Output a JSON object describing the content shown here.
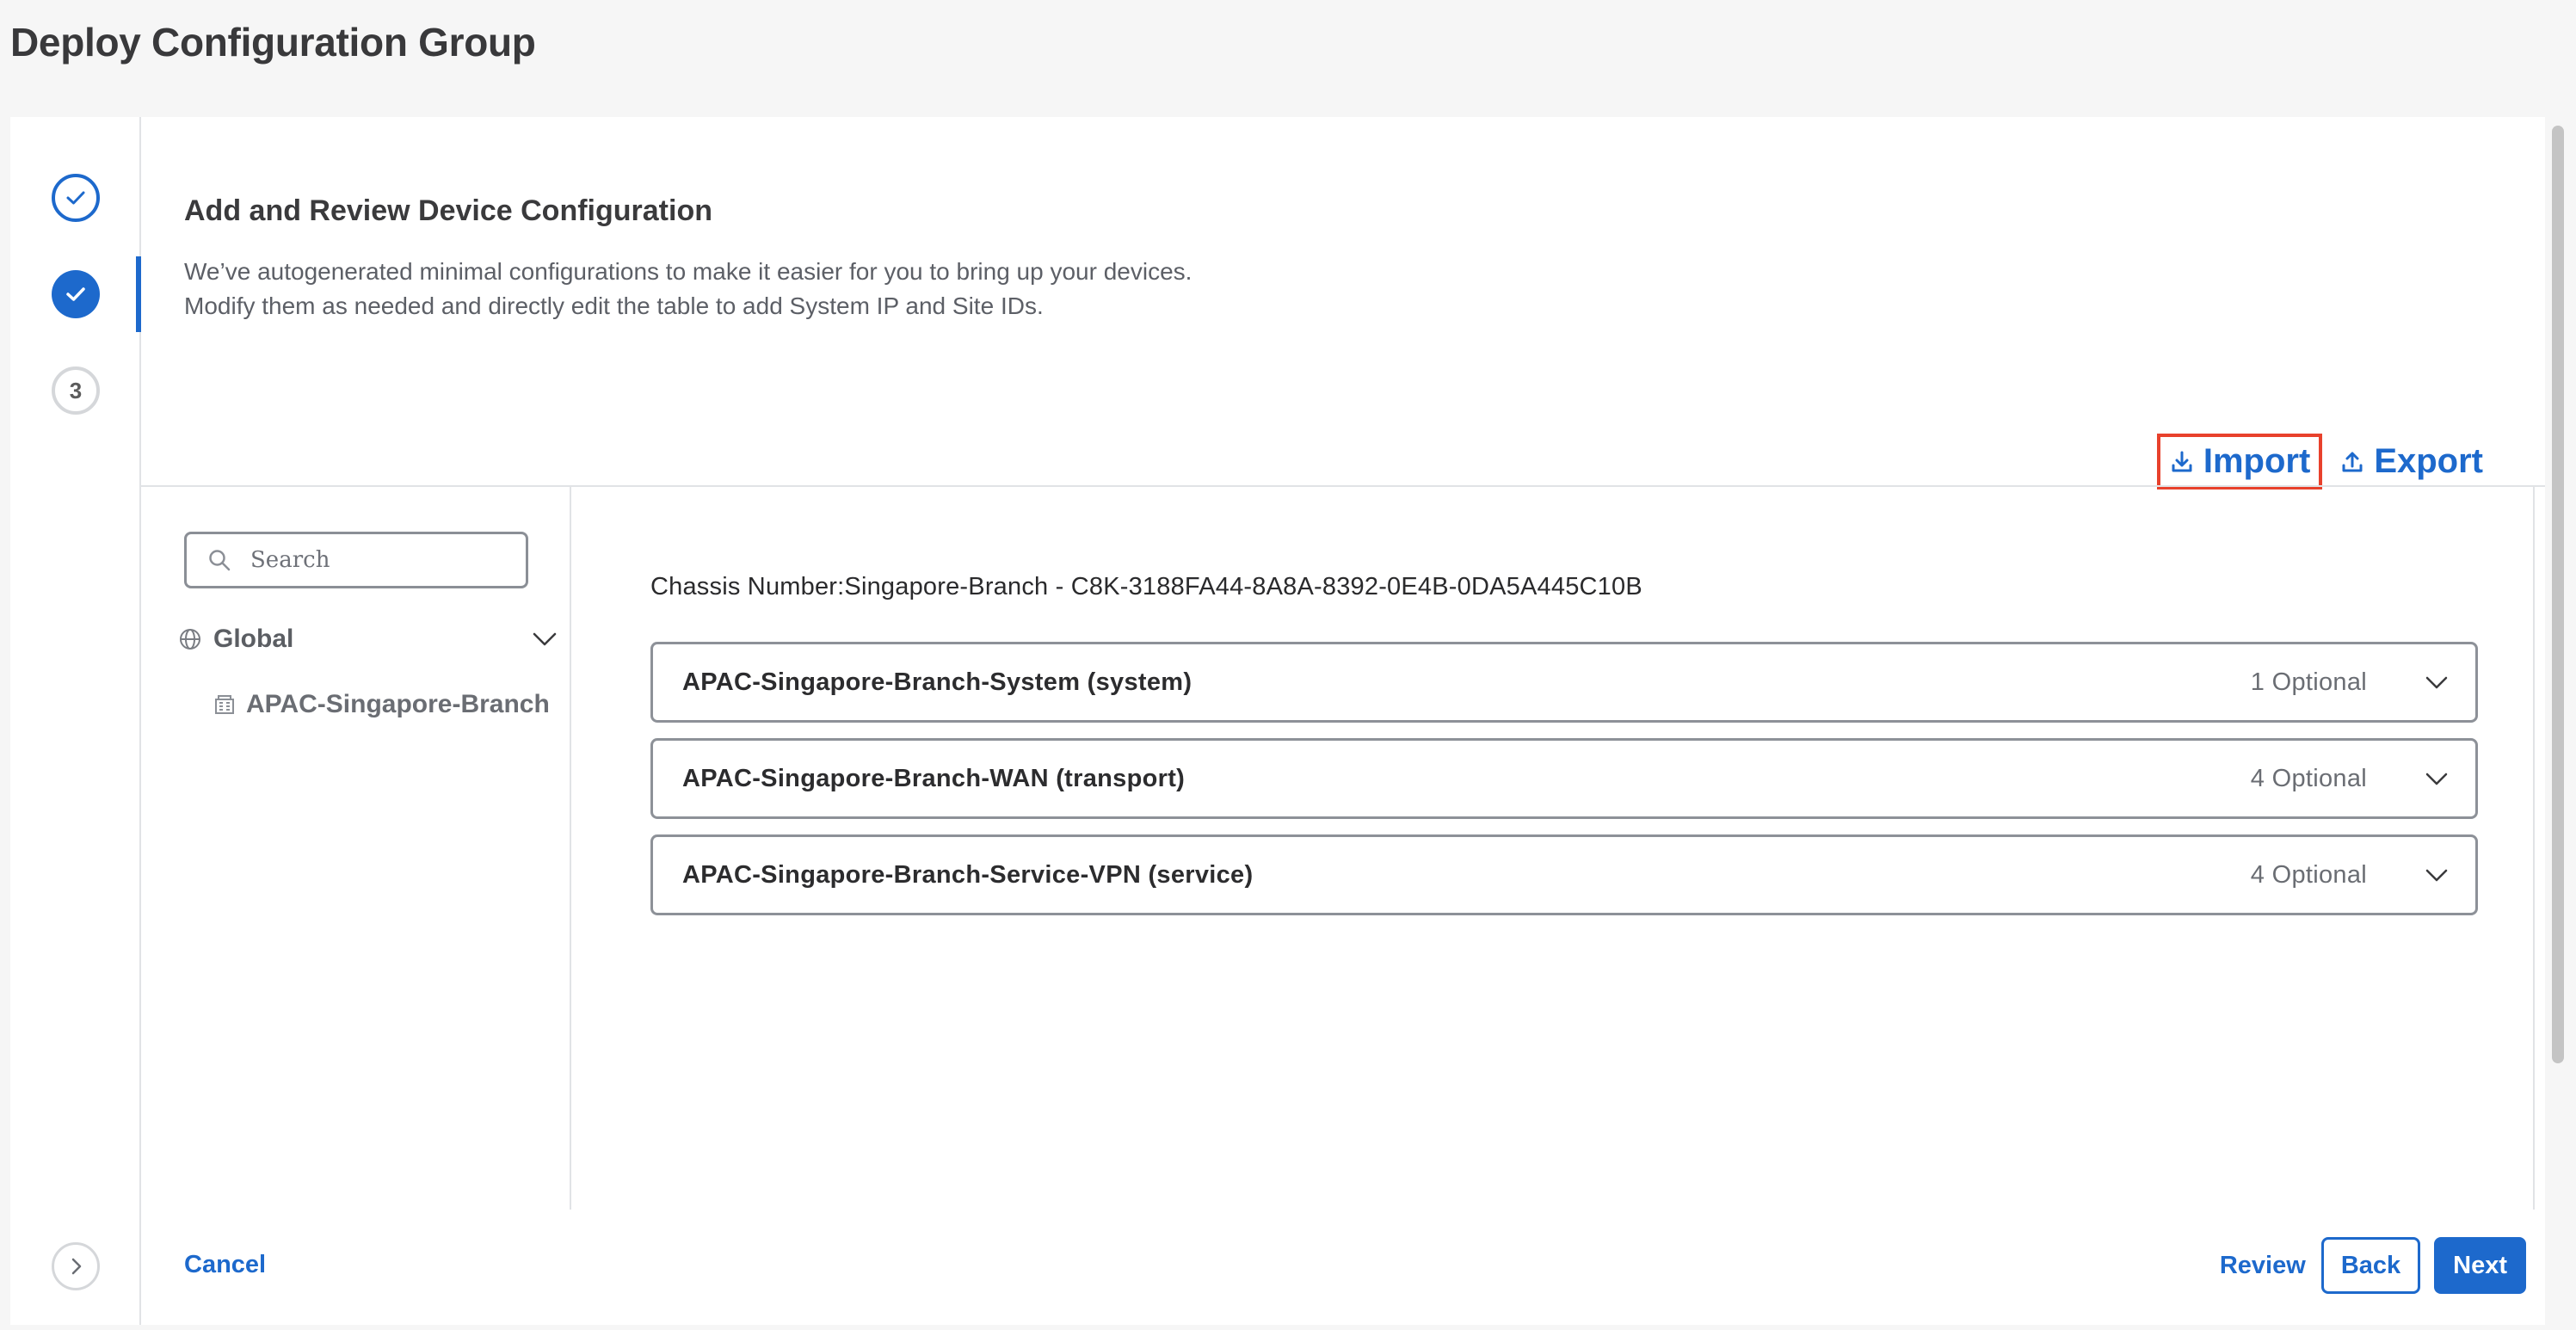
{
  "page": {
    "title": "Deploy Configuration Group"
  },
  "steps": [
    {
      "state": "complete",
      "icon": "check-icon"
    },
    {
      "state": "current",
      "icon": "check-icon"
    },
    {
      "state": "pending",
      "label": "3"
    }
  ],
  "section": {
    "heading": "Add and Review Device Configuration",
    "description_line1": "We’ve autogenerated minimal configurations to make it easier for you to bring up your devices.",
    "description_line2": "Modify them as needed and directly edit the table to add System IP and Site IDs."
  },
  "toolbar": {
    "import_label": "Import",
    "export_label": "Export",
    "highlight_color": "#e8412c"
  },
  "tree": {
    "search_placeholder": "Search",
    "root_label": "Global",
    "site_label": "APAC-Singapore-Branch"
  },
  "details": {
    "chassis_label": "Chassis Number:Singapore-Branch - C8K-3188FA44-8A8A-8392-0E4B-0DA5A445C10B",
    "profiles": [
      {
        "title": "APAC-Singapore-Branch-System (system)",
        "optional": "1 Optional"
      },
      {
        "title": "APAC-Singapore-Branch-WAN (transport)",
        "optional": "4 Optional"
      },
      {
        "title": "APAC-Singapore-Branch-Service-VPN (service)",
        "optional": "4 Optional"
      }
    ]
  },
  "footer": {
    "cancel_label": "Cancel",
    "review_label": "Review",
    "back_label": "Back",
    "next_label": "Next"
  },
  "colors": {
    "accent": "#1d69cc",
    "background": "#f6f6f6"
  }
}
